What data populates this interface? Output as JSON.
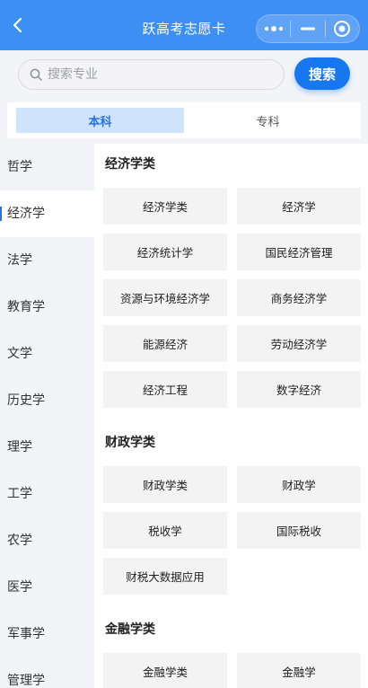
{
  "header": {
    "title": "跃高考志愿卡"
  },
  "search": {
    "placeholder": "搜索专业",
    "button": "搜索"
  },
  "tabs": [
    {
      "label": "本科",
      "active": true
    },
    {
      "label": "专科",
      "active": false
    }
  ],
  "sidebar": {
    "items": [
      {
        "label": "哲学"
      },
      {
        "label": "经济学"
      },
      {
        "label": "法学"
      },
      {
        "label": "教育学"
      },
      {
        "label": "文学"
      },
      {
        "label": "历史学"
      },
      {
        "label": "理学"
      },
      {
        "label": "工学"
      },
      {
        "label": "农学"
      },
      {
        "label": "医学"
      },
      {
        "label": "军事学"
      },
      {
        "label": "管理学"
      }
    ],
    "active": "经济学"
  },
  "groups": [
    {
      "title": "经济学类",
      "majors": [
        "经济学类",
        "经济学",
        "经济统计学",
        "国民经济管理",
        "资源与环境经济学",
        "商务经济学",
        "能源经济",
        "劳动经济学",
        "经济工程",
        "数字经济"
      ]
    },
    {
      "title": "财政学类",
      "majors": [
        "财政学类",
        "财政学",
        "税收学",
        "国际税收",
        "财税大数据应用"
      ]
    },
    {
      "title": "金融学类",
      "majors": [
        "金融学类",
        "金融学"
      ]
    }
  ],
  "colors": {
    "header": "#3d8ff4",
    "accent": "#1677f0",
    "tab_active_bg": "#cfe3fb"
  }
}
